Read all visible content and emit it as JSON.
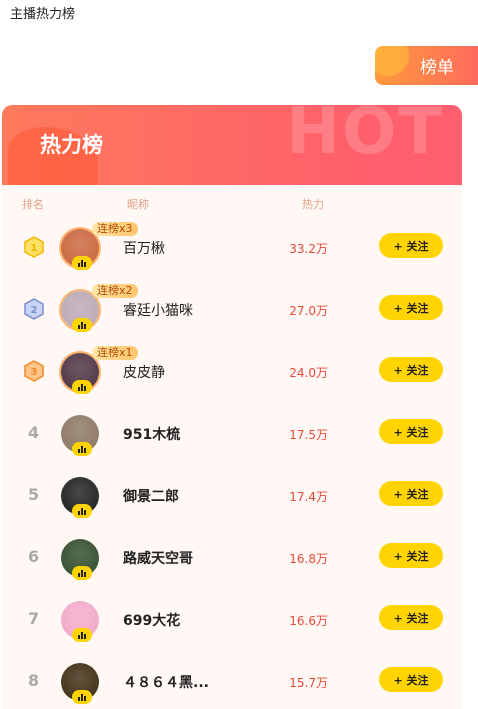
{
  "page": {
    "title": "主播热力榜"
  },
  "top_button": {
    "label": "榜单"
  },
  "panel": {
    "title": "热力榜",
    "bg_text": "HOT"
  },
  "columns": {
    "rank": "排名",
    "nickname": "昵称",
    "heat": "热力"
  },
  "follow_label": "+ 关注",
  "rows": [
    {
      "rank": "1",
      "name": "百万楸",
      "heat": "33.2万",
      "streak": "连榜x3",
      "medal": "gold",
      "avatar_color": "#c8643a"
    },
    {
      "rank": "2",
      "name": "睿廷小猫咪",
      "heat": "27.0万",
      "streak": "连榜x2",
      "medal": "silver",
      "avatar_color": "#b9a8b5"
    },
    {
      "rank": "3",
      "name": "皮皮静",
      "heat": "24.0万",
      "streak": "连榜x1",
      "medal": "bronze",
      "avatar_color": "#4a3040"
    },
    {
      "rank": "4",
      "name": "951木梳",
      "heat": "17.5万",
      "streak": "",
      "medal": "",
      "avatar_color": "#8a7560"
    },
    {
      "rank": "5",
      "name": "御景二郎",
      "heat": "17.4万",
      "streak": "",
      "medal": "",
      "avatar_color": "#1c1c1c"
    },
    {
      "rank": "6",
      "name": "路威天空哥",
      "heat": "16.8万",
      "streak": "",
      "medal": "",
      "avatar_color": "#2e4a2a"
    },
    {
      "rank": "7",
      "name": "699大花",
      "heat": "16.6万",
      "streak": "",
      "medal": "",
      "avatar_color": "#f2a8c8"
    },
    {
      "rank": "8",
      "name": "４８６４黑...",
      "heat": "15.7万",
      "streak": "",
      "medal": "",
      "avatar_color": "#3a2a10"
    }
  ],
  "colors": {
    "accent": "#ff6169",
    "follow": "#ffd400",
    "heat": "#e84a3a"
  }
}
